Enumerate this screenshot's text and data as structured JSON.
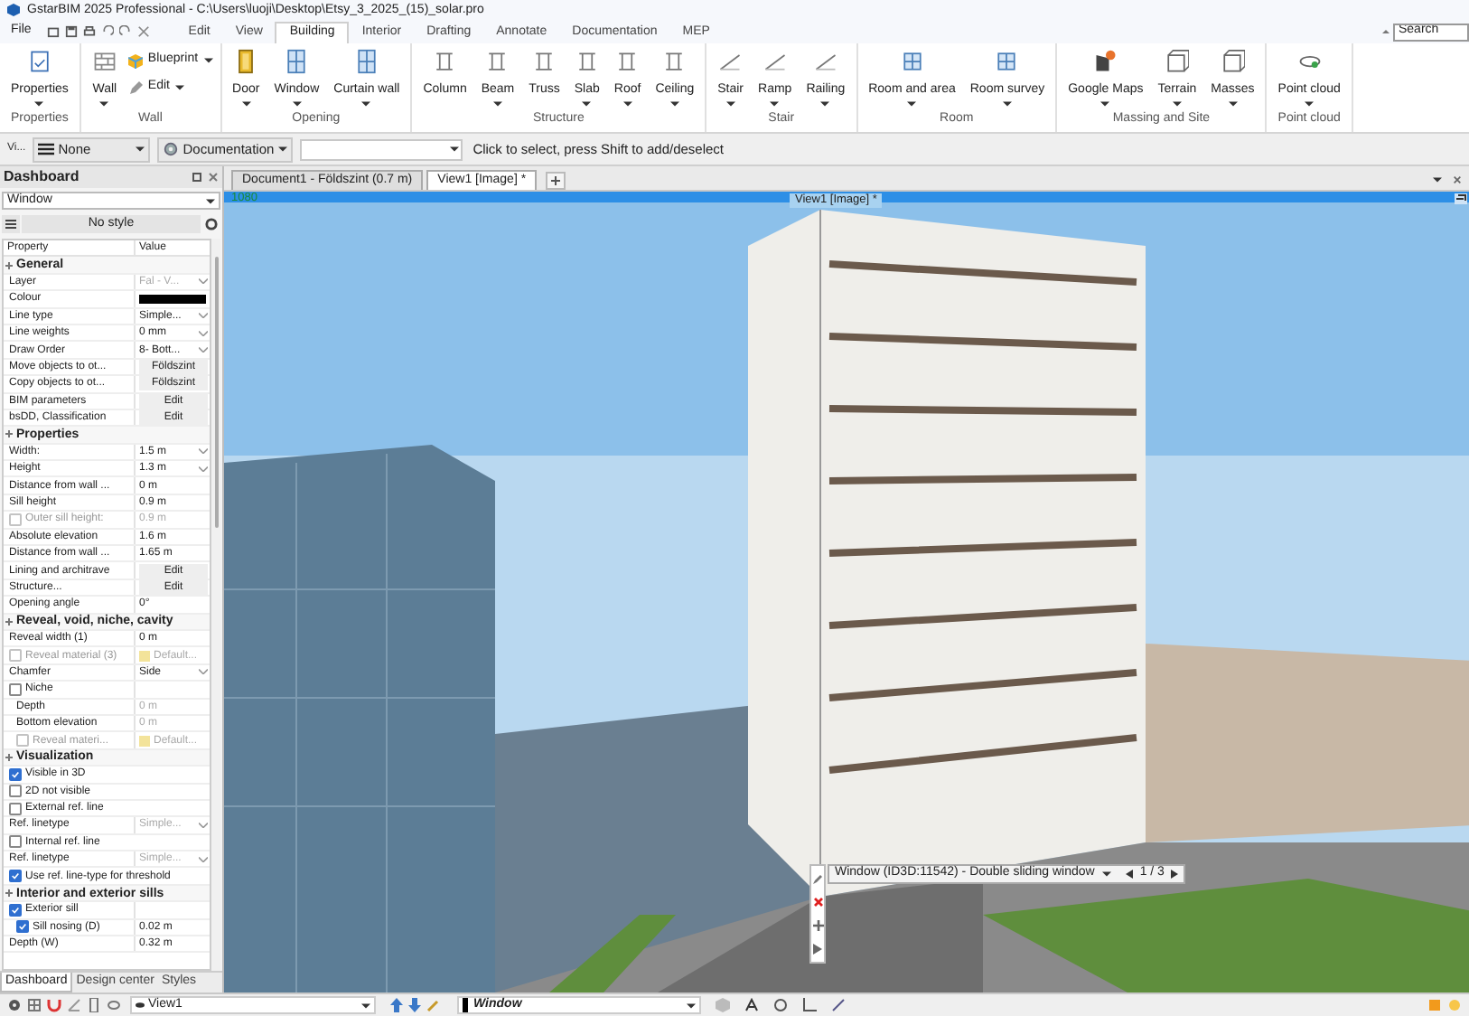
{
  "window": {
    "title": "GstarBIM 2025 Professional - C:\\Users\\luoji\\Desktop\\Etsy_3_2025_(15)_solar.pro"
  },
  "menu": {
    "file": "File",
    "tabs": [
      {
        "label": "Edit",
        "selected": false
      },
      {
        "label": "View",
        "selected": false
      },
      {
        "label": "Building",
        "selected": true
      },
      {
        "label": "Interior",
        "selected": false
      },
      {
        "label": "Drafting",
        "selected": false
      },
      {
        "label": "Annotate",
        "selected": false
      },
      {
        "label": "Documentation",
        "selected": false
      },
      {
        "label": "MEP",
        "selected": false
      }
    ],
    "search": {
      "placeholder": "Search"
    }
  },
  "ribbon": {
    "groups": [
      {
        "title": "Properties",
        "tools": [
          {
            "label": "Properties",
            "kind": "large",
            "dropdown": true
          }
        ]
      },
      {
        "title": "Wall",
        "tools": [
          {
            "label": "Wall",
            "kind": "large",
            "dropdown": true
          },
          {
            "label": "Blueprint",
            "kind": "small",
            "dropdown": true
          },
          {
            "label": "Edit",
            "kind": "small",
            "dropdown": true
          }
        ]
      },
      {
        "title": "Opening",
        "tools": [
          {
            "label": "Door",
            "kind": "large",
            "dropdown": true
          },
          {
            "label": "Window",
            "kind": "large",
            "dropdown": true
          },
          {
            "label": "Curtain wall",
            "kind": "large",
            "dropdown": true
          }
        ]
      },
      {
        "title": "Structure",
        "tools": [
          {
            "label": "Column",
            "kind": "large",
            "dropdown": false
          },
          {
            "label": "Beam",
            "kind": "large",
            "dropdown": true
          },
          {
            "label": "Truss",
            "kind": "large",
            "dropdown": false
          },
          {
            "label": "Slab",
            "kind": "large",
            "dropdown": true
          },
          {
            "label": "Roof",
            "kind": "large",
            "dropdown": true
          },
          {
            "label": "Ceiling",
            "kind": "large",
            "dropdown": true
          }
        ]
      },
      {
        "title": "Stair",
        "tools": [
          {
            "label": "Stair",
            "kind": "large",
            "dropdown": true
          },
          {
            "label": "Ramp",
            "kind": "large",
            "dropdown": true
          },
          {
            "label": "Railing",
            "kind": "large",
            "dropdown": true
          }
        ]
      },
      {
        "title": "Room",
        "tools": [
          {
            "label": "Room and area",
            "kind": "large",
            "dropdown": true
          },
          {
            "label": "Room survey",
            "kind": "large",
            "dropdown": true
          }
        ]
      },
      {
        "title": "Massing and Site",
        "tools": [
          {
            "label": "Google Maps",
            "kind": "large",
            "dropdown": true
          },
          {
            "label": "Terrain",
            "kind": "large",
            "dropdown": true
          },
          {
            "label": "Masses",
            "kind": "large",
            "dropdown": true
          }
        ]
      },
      {
        "title": "Point cloud",
        "tools": [
          {
            "label": "Point cloud",
            "kind": "large",
            "dropdown": true
          }
        ]
      }
    ]
  },
  "options_bar": {
    "view_label": "Vi...",
    "layer": "None",
    "style": "Documentation",
    "hint": "Click to select, press Shift to add/deselect"
  },
  "dashboard": {
    "title": "Dashboard",
    "element_type": "Window",
    "style": "No style",
    "columns": [
      "Property",
      "Value"
    ],
    "rows": [
      {
        "kind": "section",
        "label": "General"
      },
      {
        "kind": "property",
        "label": "Layer",
        "value": {
          "kind": "select",
          "text": "Fal - V..."
        },
        "disabled": true
      },
      {
        "kind": "property",
        "label": "Colour",
        "value": {
          "kind": "swatch"
        },
        "disabled": false
      },
      {
        "kind": "property",
        "label": "Line type",
        "value": {
          "kind": "select",
          "text": "Simple..."
        },
        "disabled": false
      },
      {
        "kind": "property",
        "label": "Line weights",
        "value": {
          "kind": "select",
          "text": "0 mm"
        },
        "disabled": false
      },
      {
        "kind": "property",
        "label": "Draw Order",
        "value": {
          "kind": "select",
          "text": "8- Bott..."
        },
        "disabled": false
      },
      {
        "kind": "property",
        "label": "Move objects to ot...",
        "value": {
          "kind": "button",
          "text": "Földszint"
        },
        "disabled": false
      },
      {
        "kind": "property",
        "label": "Copy objects to ot...",
        "value": {
          "kind": "button",
          "text": "Földszint"
        },
        "disabled": false
      },
      {
        "kind": "property",
        "label": "BIM parameters",
        "value": {
          "kind": "button",
          "text": "Edit"
        },
        "disabled": false
      },
      {
        "kind": "property",
        "label": "bsDD, Classification",
        "value": {
          "kind": "button",
          "text": "Edit"
        },
        "disabled": false
      },
      {
        "kind": "section",
        "label": "Properties"
      },
      {
        "kind": "property",
        "label": "Width:",
        "value": {
          "kind": "select",
          "text": "1.5 m"
        },
        "disabled": false
      },
      {
        "kind": "property",
        "label": "Height",
        "value": {
          "kind": "select",
          "text": "1.3 m"
        },
        "disabled": false
      },
      {
        "kind": "property",
        "label": "Distance from wall ...",
        "value": {
          "kind": "text",
          "text": "0 m"
        },
        "disabled": false
      },
      {
        "kind": "property",
        "label": "Sill height",
        "value": {
          "kind": "text",
          "text": "0.9 m"
        },
        "disabled": false
      },
      {
        "kind": "check",
        "label": "Outer sill height:",
        "checked": false,
        "value": {
          "kind": "text",
          "text": "0.9 m"
        },
        "disabled": true
      },
      {
        "kind": "property",
        "label": "Absolute elevation",
        "value": {
          "kind": "text",
          "text": "1.6 m"
        },
        "disabled": false
      },
      {
        "kind": "property",
        "label": "Distance from wall ...",
        "value": {
          "kind": "text",
          "text": "1.65 m"
        },
        "disabled": false
      },
      {
        "kind": "property",
        "label": "Lining and architrave",
        "value": {
          "kind": "button",
          "text": "Edit"
        },
        "disabled": false
      },
      {
        "kind": "property",
        "label": "Structure...",
        "value": {
          "kind": "button",
          "text": "Edit"
        },
        "disabled": false
      },
      {
        "kind": "property",
        "label": "Opening angle",
        "value": {
          "kind": "text",
          "text": "0°"
        },
        "disabled": false
      },
      {
        "kind": "section",
        "label": "Reveal, void, niche, cavity"
      },
      {
        "kind": "property",
        "label": "Reveal width (1)",
        "value": {
          "kind": "text",
          "text": "0 m"
        },
        "disabled": false
      },
      {
        "kind": "check",
        "label": "Reveal material (3)",
        "checked": false,
        "value": {
          "kind": "material",
          "text": "Default..."
        },
        "disabled": true
      },
      {
        "kind": "property",
        "label": "Chamfer",
        "value": {
          "kind": "select",
          "text": "Side"
        },
        "disabled": false
      },
      {
        "kind": "check",
        "label": "Niche",
        "checked": false,
        "disabled": false,
        "children": [
          {
            "kind": "property",
            "label": "Depth",
            "value": {
              "kind": "text",
              "text": "0 m"
            },
            "disabled": true
          },
          {
            "kind": "property",
            "label": "Bottom elevation",
            "value": {
              "kind": "text",
              "text": "0 m"
            },
            "disabled": true
          },
          {
            "kind": "check",
            "label": "Reveal materi...",
            "checked": false,
            "value": {
              "kind": "material",
              "text": "Default..."
            },
            "disabled": true
          }
        ]
      },
      {
        "kind": "section",
        "label": "Visualization"
      },
      {
        "kind": "check",
        "label": "Visible in 3D",
        "checked": true,
        "disabled": false
      },
      {
        "kind": "check",
        "label": "2D not visible",
        "checked": false,
        "disabled": false
      },
      {
        "kind": "check",
        "label": "External ref. line",
        "checked": false,
        "disabled": false
      },
      {
        "kind": "property",
        "label": "Ref. linetype",
        "value": {
          "kind": "select",
          "text": "Simple..."
        },
        "disabled": true
      },
      {
        "kind": "check",
        "label": "Internal ref. line",
        "checked": false,
        "disabled": false
      },
      {
        "kind": "property",
        "label": "Ref. linetype",
        "value": {
          "kind": "select",
          "text": "Simple..."
        },
        "disabled": true
      },
      {
        "kind": "check",
        "label": "Use ref. line-type for threshold",
        "checked": true,
        "disabled": false
      },
      {
        "kind": "section",
        "label": "Interior and exterior sills"
      },
      {
        "kind": "check",
        "label": "Exterior sill",
        "checked": true,
        "disabled": false,
        "children": [
          {
            "kind": "check",
            "label": "Sill nosing (D)",
            "checked": true,
            "value": {
              "kind": "text",
              "text": "0.02 m"
            },
            "disabled": false
          }
        ]
      },
      {
        "kind": "property",
        "label": "Depth (W)",
        "value": {
          "kind": "text",
          "text": "0.32 m"
        },
        "disabled": false
      }
    ],
    "tabs": [
      {
        "label": "Dashboard",
        "selected": true
      },
      {
        "label": "Design center",
        "selected": false
      },
      {
        "label": "Styles",
        "selected": false
      }
    ]
  },
  "document_tabs": [
    {
      "label": "Document1 - Földszint (0.7 m)",
      "selected": false
    },
    {
      "label": "View1 [Image] *",
      "selected": true
    }
  ],
  "viewport": {
    "resolution": "1080",
    "view_label": "View1 [Image] *",
    "popup": {
      "text": "Window (ID3D:11542) - Double sliding window",
      "page": "1 / 3"
    }
  },
  "status_bar": {
    "view": "View1",
    "element": "Window"
  }
}
